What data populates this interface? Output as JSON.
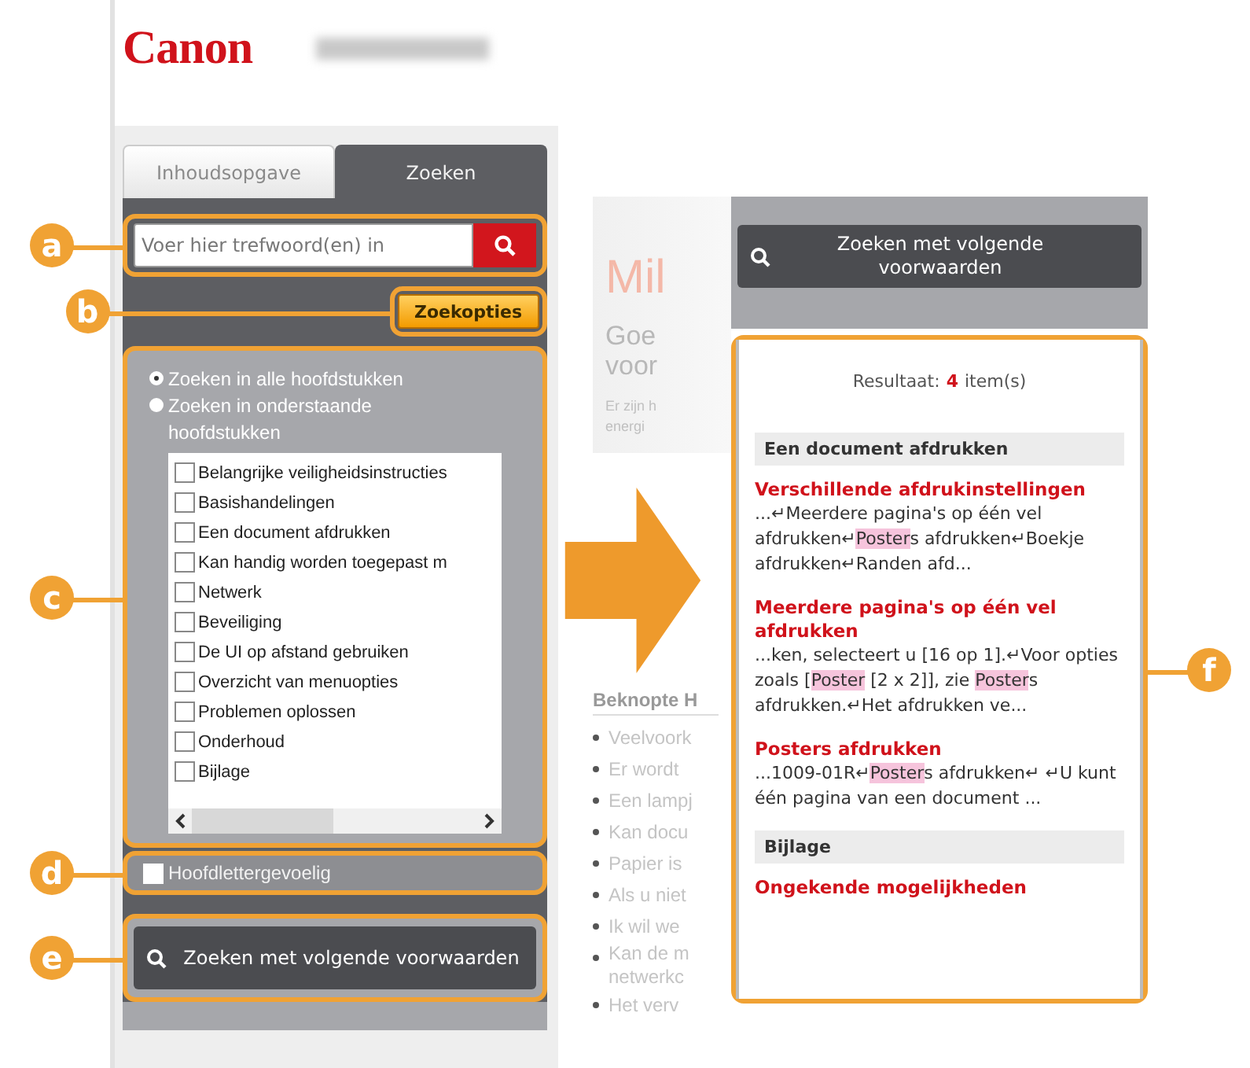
{
  "logo": "Canon",
  "tabs": [
    {
      "label": "Inhoudsopgave",
      "selected": false
    },
    {
      "label": "Zoeken",
      "selected": true
    }
  ],
  "search": {
    "callout": "a",
    "placeholder": "Voer hier trefwoord(en) in"
  },
  "options_button": {
    "callout": "b",
    "label": "Zoekopties"
  },
  "scope": {
    "callout": "c",
    "radios": [
      {
        "label": "Zoeken in alle hoofdstukken",
        "selected": true
      },
      {
        "label": "Zoeken in onderstaande hoofdstukken",
        "selected": false
      }
    ],
    "chapters": [
      {
        "label": "Belangrijke veiligheidsinstructies",
        "checked": false
      },
      {
        "label": "Basishandelingen",
        "checked": false
      },
      {
        "label": "Een document afdrukken",
        "checked": false
      },
      {
        "label": "Kan handig worden toegepast m",
        "checked": false
      },
      {
        "label": "Netwerk",
        "checked": false
      },
      {
        "label": "Beveiliging",
        "checked": false
      },
      {
        "label": "De UI op afstand gebruiken",
        "checked": false
      },
      {
        "label": "Overzicht van menuopties",
        "checked": false
      },
      {
        "label": "Problemen oplossen",
        "checked": false
      },
      {
        "label": "Onderhoud",
        "checked": false
      },
      {
        "label": "Bijlage",
        "checked": false
      }
    ]
  },
  "case_sensitive": {
    "callout": "d",
    "label": "Hoofdlettergevoelig",
    "checked": false
  },
  "search_button": {
    "callout": "e",
    "label": "Zoeken met volgende voorwaarden"
  },
  "background_page": {
    "title": "Mil",
    "heading": [
      "Goe",
      "voor"
    ],
    "intro": [
      "Er zijn h",
      "energi"
    ],
    "section_title": "Beknopte H",
    "bullets": [
      "Veelvoork",
      "Er wordt",
      "Een lampj",
      "Kan docu",
      "Papier is",
      "Als u niet",
      "Ik wil we",
      "Kan de m netwerkc",
      "Het verv"
    ]
  },
  "results_panel": {
    "search_button": {
      "label": "Zoeken met volgende voorwaarden"
    },
    "callout": "f",
    "summary": {
      "label": "Resultaat:",
      "count": "4",
      "unit": "item(s)"
    },
    "groups": [
      {
        "title": "Een document afdrukken",
        "items": [
          {
            "title": "Verschillende afdrukinstellingen",
            "snippet": [
              {
                "text": "...↵Meerdere pagina's op één vel afdrukken↵",
                "highlighted": false
              },
              {
                "text": "Poster",
                "highlighted": true
              },
              {
                "text": "s afdrukken↵Boekje afdrukken↵Randen afd...",
                "highlighted": false
              }
            ]
          },
          {
            "title": "Meerdere pagina's op één vel afdrukken",
            "snippet": [
              {
                "text": "...ken, selecteert u [16 op 1].↵Voor opties zoals [",
                "highlighted": false
              },
              {
                "text": "Poster",
                "highlighted": true
              },
              {
                "text": " [2 x 2]], zie ",
                "highlighted": false
              },
              {
                "text": "Poster",
                "highlighted": true
              },
              {
                "text": "s afdrukken.↵Het afdrukken ve...",
                "highlighted": false
              }
            ]
          },
          {
            "title": "Posters afdrukken",
            "snippet": [
              {
                "text": "...1009-01R↵",
                "highlighted": false
              },
              {
                "text": "Poster",
                "highlighted": true
              },
              {
                "text": "s afdrukken↵ ↵U kunt één pagina van een document ...",
                "highlighted": false
              }
            ]
          }
        ]
      },
      {
        "title": "Bijlage",
        "items": [
          {
            "title": "Ongekende mogelijkheden"
          }
        ]
      }
    ]
  }
}
